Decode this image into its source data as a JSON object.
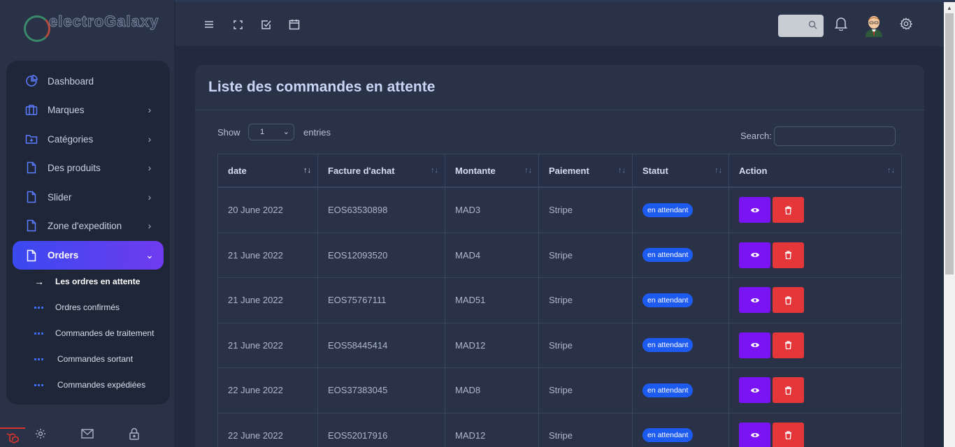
{
  "brand": {
    "name": "electroGalaxy"
  },
  "sidebar": {
    "items": [
      {
        "label": "Dashboard",
        "icon": "pie-chart-icon",
        "has_children": false
      },
      {
        "label": "Marques",
        "icon": "briefcase-icon",
        "has_children": true
      },
      {
        "label": "Catégories",
        "icon": "folder-plus-icon",
        "has_children": true
      },
      {
        "label": "Des produits",
        "icon": "file-icon",
        "has_children": true
      },
      {
        "label": "Slider",
        "icon": "file-icon",
        "has_children": true
      },
      {
        "label": "Zone d'expedition",
        "icon": "file-icon",
        "has_children": true
      },
      {
        "label": "Orders",
        "icon": "file-icon",
        "has_children": true,
        "active": true
      }
    ],
    "subitems": [
      {
        "label": "Les ordres en attente",
        "current": true
      },
      {
        "label": "Ordres confirmés"
      },
      {
        "label": "Commandes de traitement"
      },
      {
        "label": "Commandes sortant"
      },
      {
        "label": "Commandes expédiées"
      }
    ],
    "footer_icons": [
      "settings-icon",
      "mail-icon",
      "lock-icon"
    ]
  },
  "topbar": {
    "icons": [
      "menu-icon",
      "fullscreen-icon",
      "checkbox-icon",
      "calendar-icon"
    ],
    "right_icons": [
      "search-icon",
      "bell-icon",
      "avatar",
      "settings-icon"
    ]
  },
  "page": {
    "title": "Liste des commandes en attente",
    "show_label": "Show",
    "show_value": "1",
    "entries_label": "entries",
    "search_label": "Search:"
  },
  "table": {
    "columns": [
      "date",
      "Facture d'achat",
      "Montante",
      "Paiement",
      "Statut",
      "Action"
    ],
    "rows": [
      {
        "date": "20 June 2022",
        "invoice": "EOS63530898",
        "amount": "MAD3",
        "payment": "Stripe",
        "status": "en attendant"
      },
      {
        "date": "21 June 2022",
        "invoice": "EOS12093520",
        "amount": "MAD4",
        "payment": "Stripe",
        "status": "en attendant"
      },
      {
        "date": "21 June 2022",
        "invoice": "EOS75767111",
        "amount": "MAD51",
        "payment": "Stripe",
        "status": "en attendant"
      },
      {
        "date": "21 June 2022",
        "invoice": "EOS58445414",
        "amount": "MAD12",
        "payment": "Stripe",
        "status": "en attendant"
      },
      {
        "date": "22 June 2022",
        "invoice": "EOS37383045",
        "amount": "MAD8",
        "payment": "Stripe",
        "status": "en attendant"
      },
      {
        "date": "22 June 2022",
        "invoice": "EOS52017916",
        "amount": "MAD12",
        "payment": "Stripe",
        "status": "en attendant"
      }
    ]
  },
  "colors": {
    "accent_gradient_start": "#3a49f0",
    "accent_gradient_end": "#6f3bf0",
    "view_button": "#7b14f5",
    "delete_button": "#e5373a",
    "status_badge": "#1d5bf0"
  }
}
